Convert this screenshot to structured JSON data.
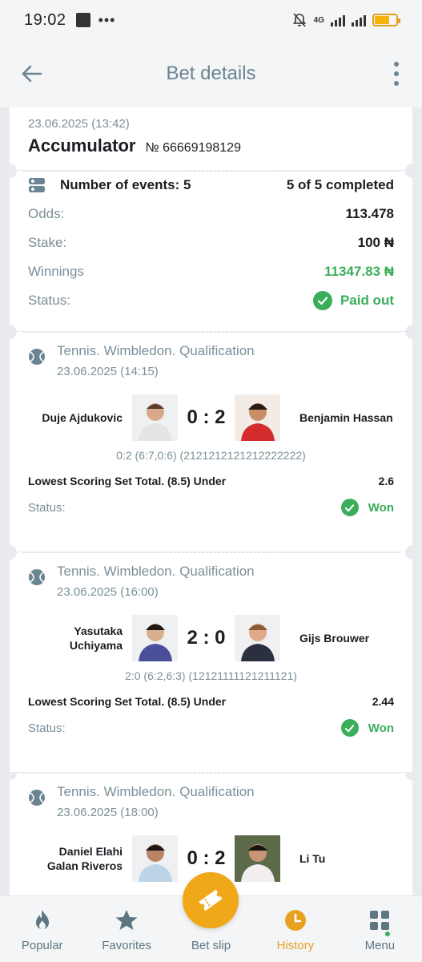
{
  "status_bar": {
    "time": "19:02",
    "network": "4G"
  },
  "app_bar": {
    "title": "Bet details"
  },
  "bet": {
    "date": "23.06.2025 (13:42)",
    "type": "Accumulator",
    "number": "№ 66669198129"
  },
  "summary": {
    "events_label": "Number of events: 5",
    "completed": "5 of 5 completed",
    "odds_label": "Odds:",
    "odds": "113.478",
    "stake_label": "Stake:",
    "stake": "100 ₦",
    "winnings_label": "Winnings",
    "winnings": "11347.83 ₦",
    "status_label": "Status:",
    "status": "Paid out"
  },
  "events": [
    {
      "title": "Tennis. Wimbledon. Qualification",
      "date": "23.06.2025 (14:15)",
      "player1": "Duje Ajdukovic",
      "player2": "Benjamin Hassan",
      "score": "0 : 2",
      "sets": "0:2 (6:7,0:6) (2121212121212222222)",
      "market": "Lowest Scoring Set Total. (8.5) Under",
      "odds": "2.6",
      "status_label": "Status:",
      "status": "Won"
    },
    {
      "title": "Tennis. Wimbledon. Qualification",
      "date": "23.06.2025 (16:00)",
      "player1": "Yasutaka Uchiyama",
      "player2": "Gijs Brouwer",
      "score": "2 : 0",
      "sets": "2:0 (6:2,6:3) (12121111121211121)",
      "market": "Lowest Scoring Set Total. (8.5) Under",
      "odds": "2.44",
      "status_label": "Status:",
      "status": "Won"
    },
    {
      "title": "Tennis. Wimbledon. Qualification",
      "date": "23.06.2025 (18:00)",
      "player1": "Daniel Elahi Galan Riveros",
      "player2": "Li Tu",
      "score": "0 : 2"
    }
  ],
  "nav": {
    "popular": "Popular",
    "favorites": "Favorites",
    "bet_slip": "Bet slip",
    "history": "History",
    "menu": "Menu"
  },
  "colors": {
    "accent": "#f0a819",
    "success": "#3aae5a",
    "muted": "#7c8f99",
    "title": "#6b8491"
  }
}
